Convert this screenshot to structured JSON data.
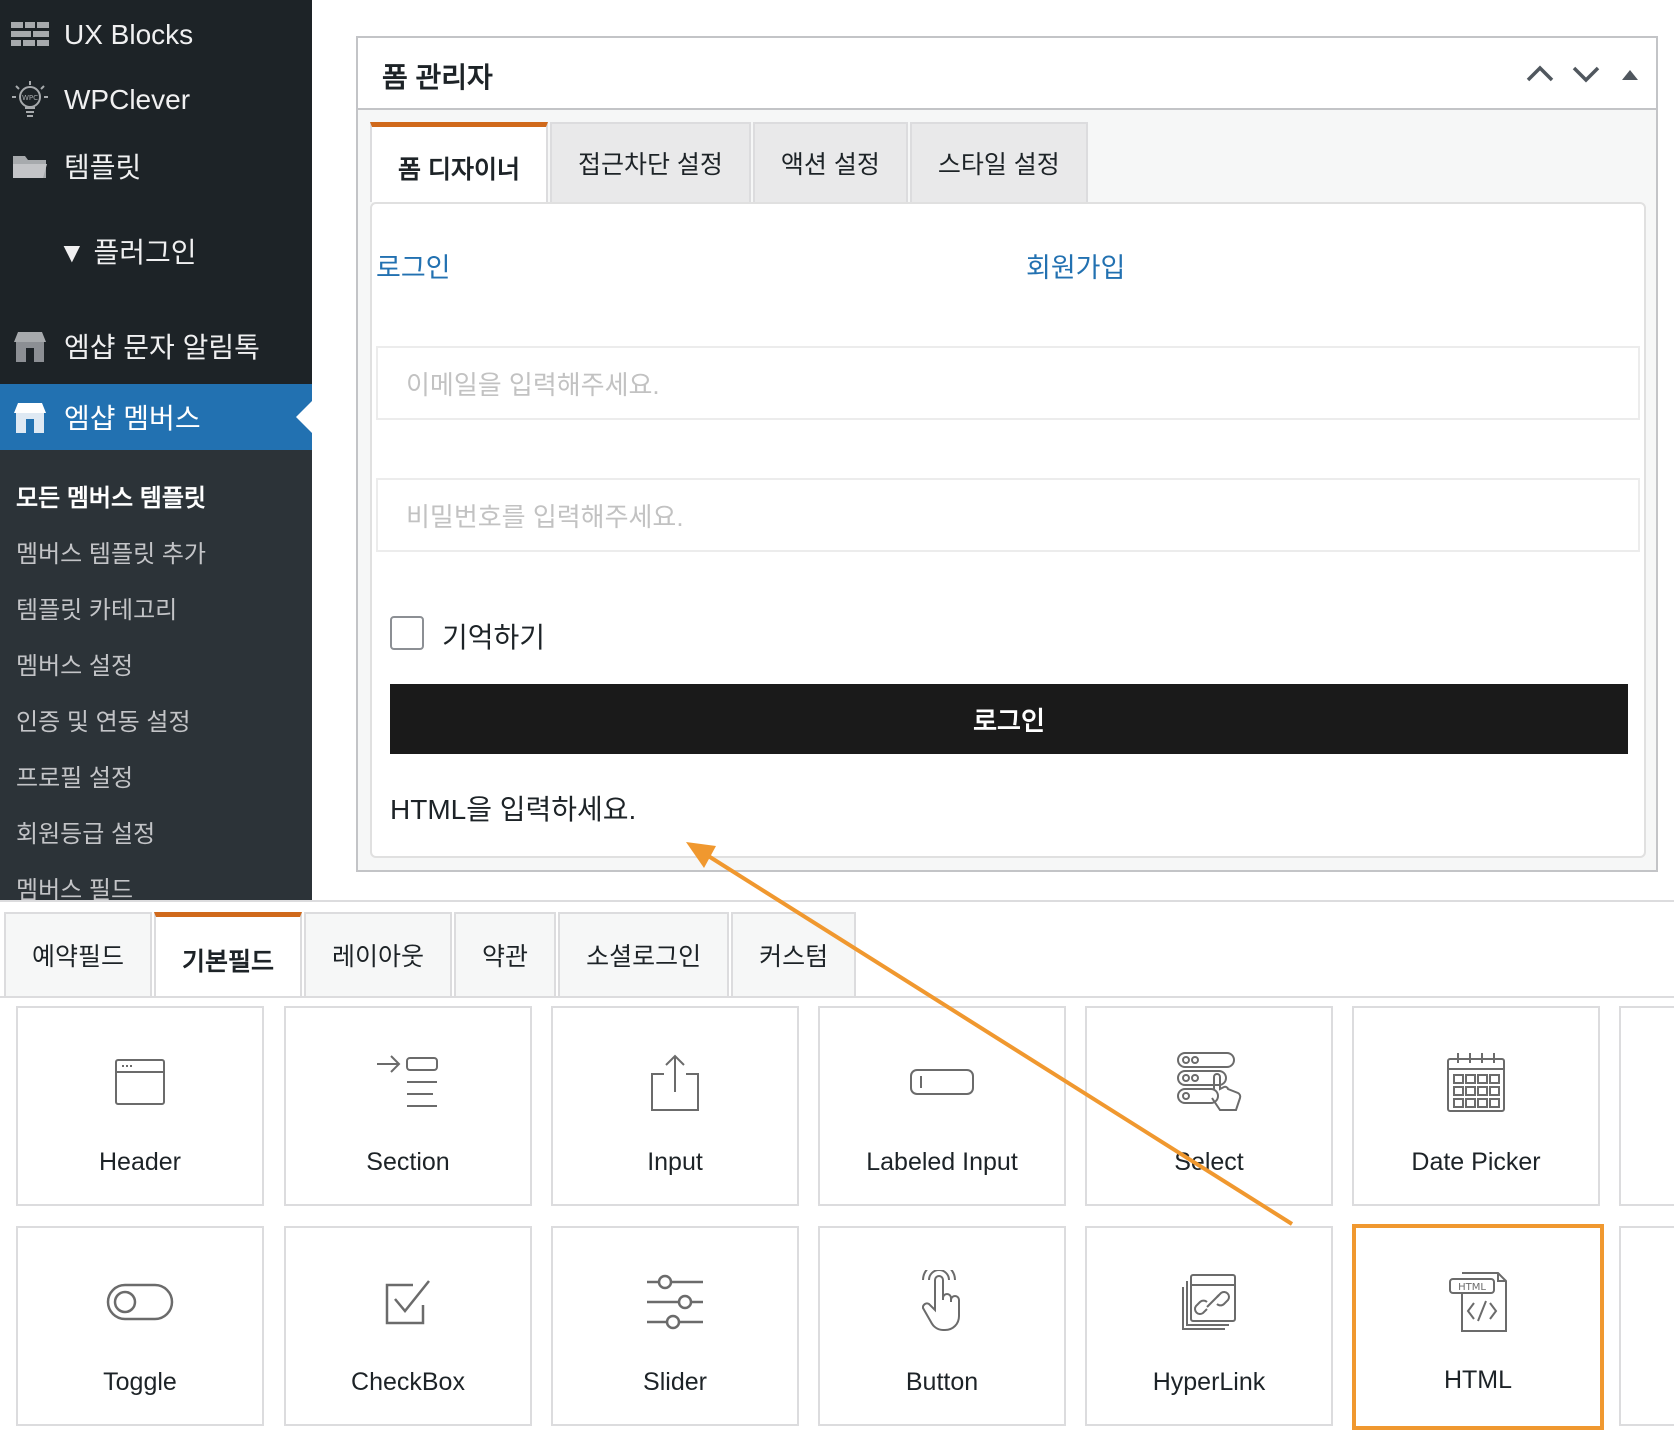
{
  "sidebar": {
    "menu": [
      {
        "label": "UX Blocks",
        "icon": "blocks-icon"
      },
      {
        "label": "WPClever",
        "icon": "lightbulb-icon"
      },
      {
        "label": "템플릿",
        "icon": "folder-icon"
      },
      {
        "label": "▼ 플러그인",
        "icon": ""
      },
      {
        "label": "엠샵 문자 알림톡",
        "icon": "shop-icon"
      },
      {
        "label": "엠샵 멤버스",
        "icon": "shop-icon"
      }
    ],
    "submenu": [
      "모든 멤버스 템플릿",
      "멤버스 템플릿 추가",
      "템플릿 카테고리",
      "멤버스 설정",
      "인증 및 연동 설정",
      "프로필 설정",
      "회원등급 설정",
      "멤버스 필드"
    ]
  },
  "panel": {
    "title": "폼 관리자",
    "tabs": [
      "폼 디자이너",
      "접근차단 설정",
      "액션 설정",
      "스타일 설정"
    ],
    "form": {
      "link_login": "로그인",
      "link_signup": "회원가입",
      "email_placeholder": "이메일을 입력해주세요.",
      "password_placeholder": "비밀번호를 입력해주세요.",
      "remember_label": "기억하기",
      "login_button": "로그인",
      "html_text": "HTML을 입력하세요."
    }
  },
  "palette": {
    "tabs": [
      "예약필드",
      "기본필드",
      "레이아웃",
      "약관",
      "소셜로그인",
      "커스텀"
    ],
    "widgets": [
      {
        "label": "Header",
        "icon": "header-icon"
      },
      {
        "label": "Section",
        "icon": "section-icon"
      },
      {
        "label": "Input",
        "icon": "input-icon"
      },
      {
        "label": "Labeled Input",
        "icon": "labeled-input-icon"
      },
      {
        "label": "Select",
        "icon": "select-icon"
      },
      {
        "label": "Date Picker",
        "icon": "calendar-icon"
      },
      {
        "label": "Toggle",
        "icon": "toggle-icon"
      },
      {
        "label": "CheckBox",
        "icon": "checkbox-icon"
      },
      {
        "label": "Slider",
        "icon": "slider-icon"
      },
      {
        "label": "Button",
        "icon": "tap-icon"
      },
      {
        "label": "HyperLink",
        "icon": "hyperlink-icon"
      },
      {
        "label": "HTML",
        "icon": "html-icon"
      }
    ]
  },
  "colors": {
    "sidebar_bg": "#1d2327",
    "active_menu": "#2271b1",
    "tab_accent": "#d0691b",
    "highlight": "#f0982f",
    "link": "#2271b1"
  }
}
